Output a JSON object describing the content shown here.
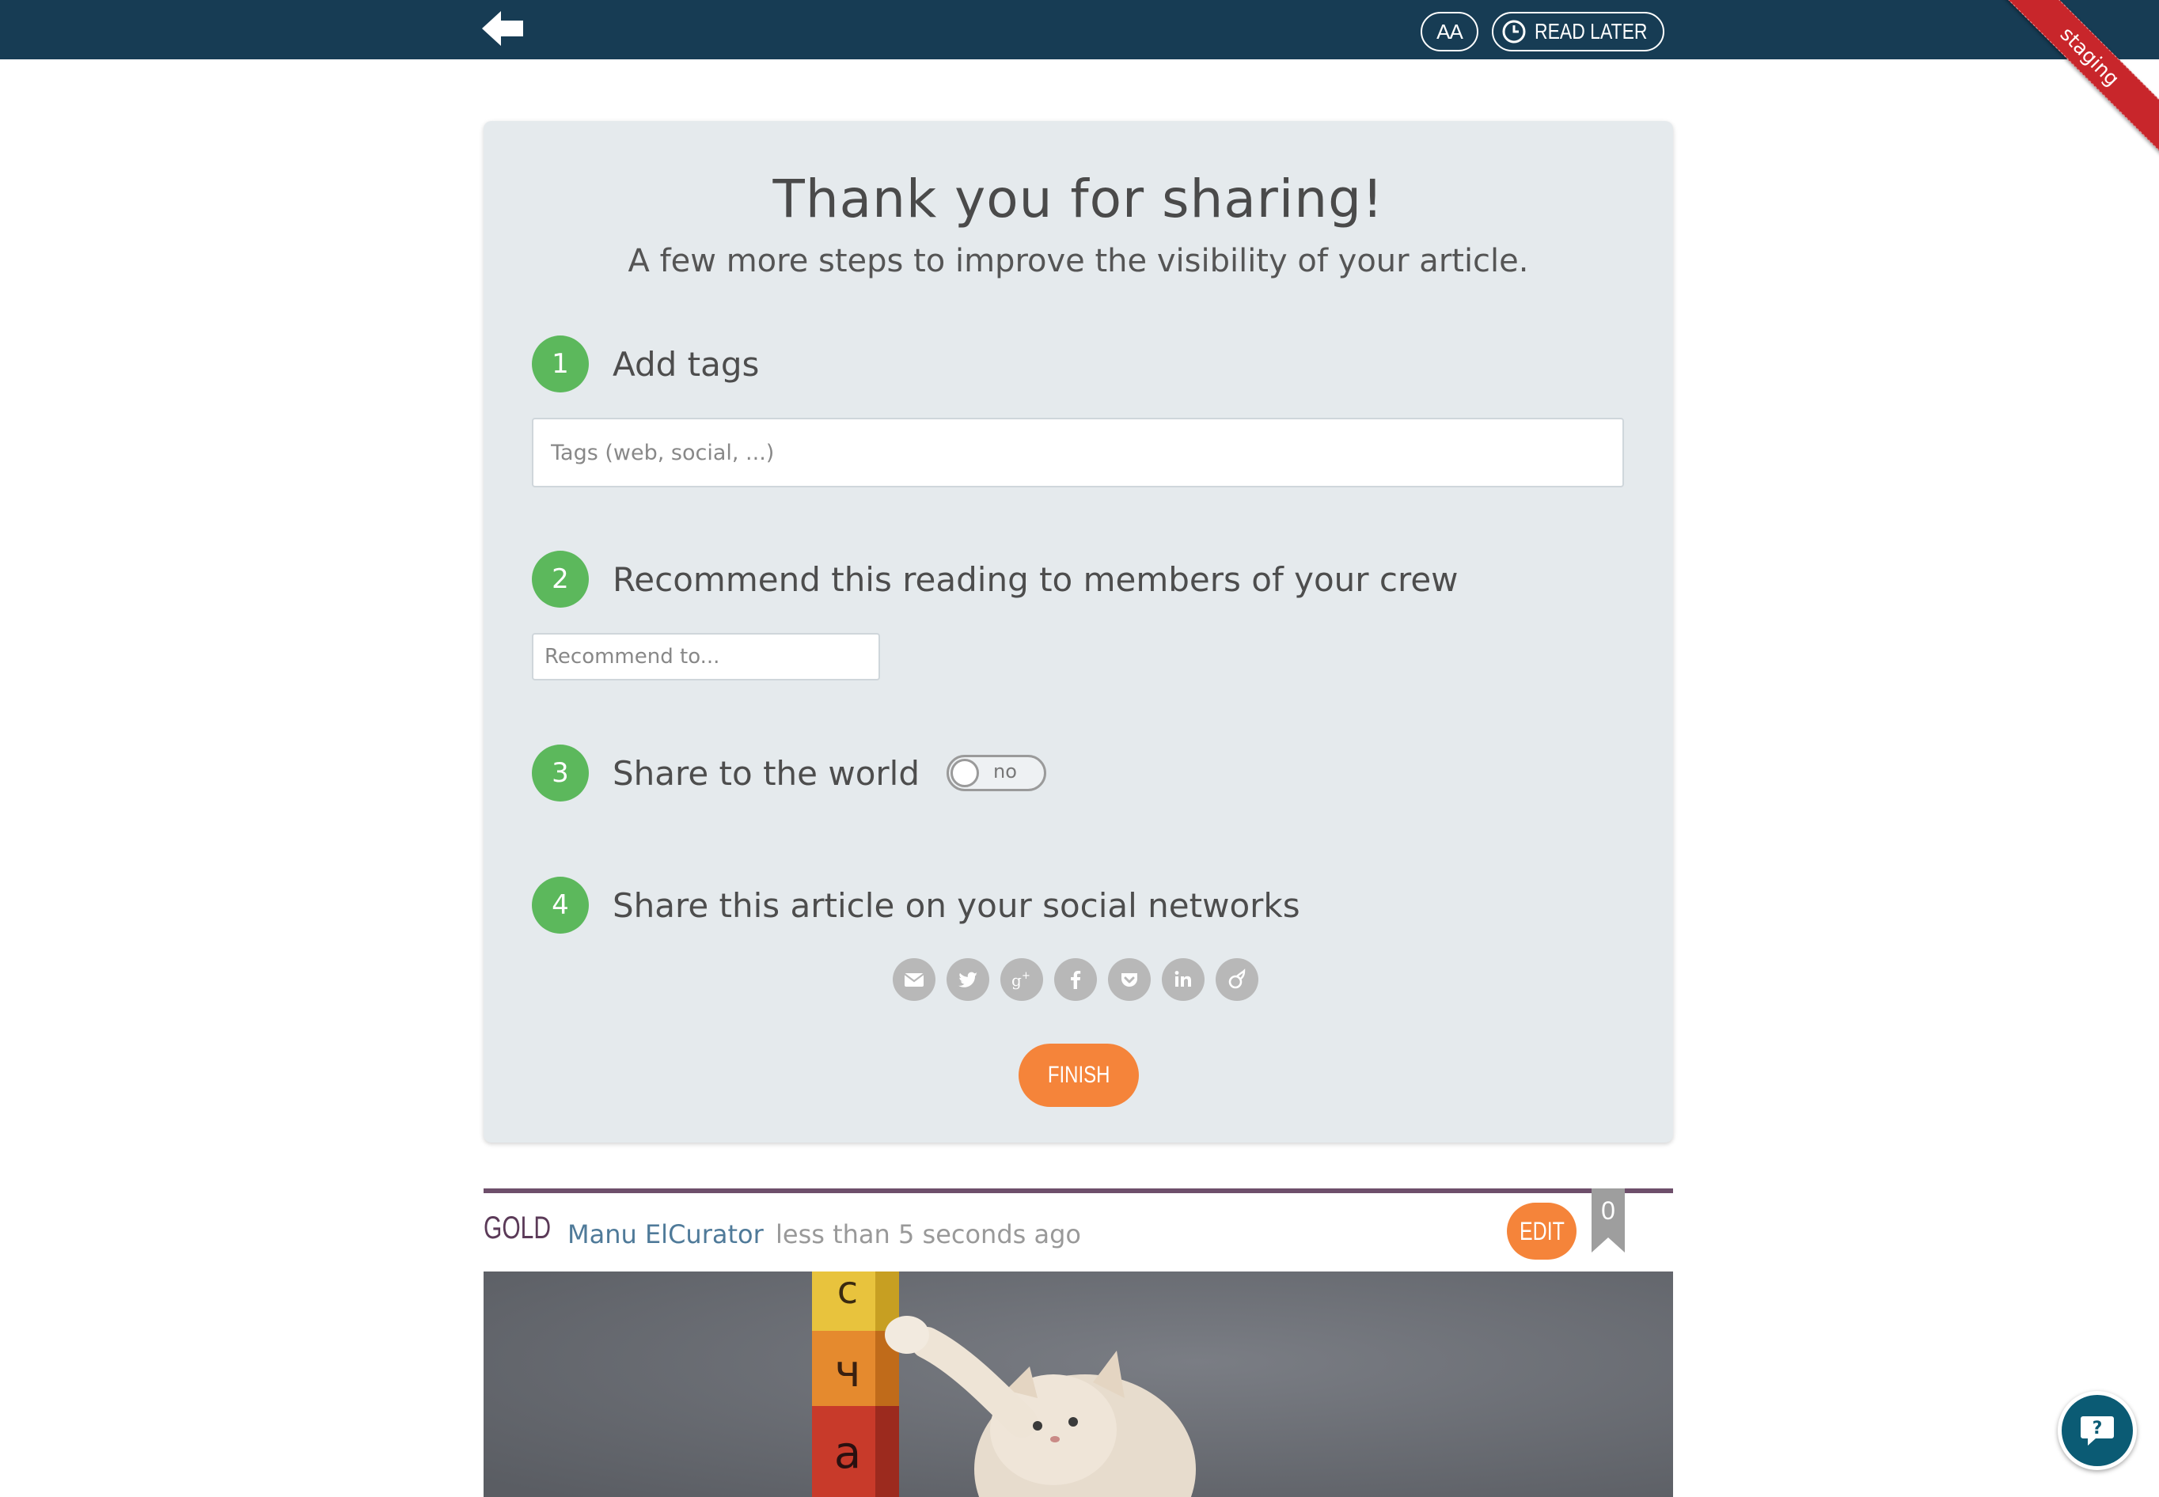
{
  "header": {
    "font_size_label": "AA",
    "read_later_label": "READ LATER",
    "env_ribbon": "staging"
  },
  "card": {
    "title": "Thank you for sharing!",
    "subtitle": "A few more steps to improve the visibility of your article.",
    "steps": [
      {
        "number": "1",
        "label": "Add tags"
      },
      {
        "number": "2",
        "label": "Recommend this reading to members of your crew"
      },
      {
        "number": "3",
        "label": "Share to the world"
      },
      {
        "number": "4",
        "label": "Share this article on your social networks"
      }
    ],
    "tags_placeholder": "Tags (web, social, ...)",
    "recommend_placeholder": "Recommend to...",
    "share_toggle": {
      "label": "no",
      "on": false
    },
    "social_icons": [
      "email-icon",
      "twitter-icon",
      "google-plus-icon",
      "facebook-icon",
      "pocket-icon",
      "linkedin-icon",
      "viadeo-icon"
    ],
    "finish_label": "FINISH"
  },
  "article": {
    "category": "GOLD",
    "author": "Manu ElCurator",
    "time": "less than 5 seconds ago",
    "edit_label": "EDIT",
    "bookmark_count": "0"
  },
  "colors": {
    "topbar": "#173c54",
    "step_green": "#5cb85c",
    "accent_orange": "#f5843a",
    "ribbon_red": "#c8262b",
    "card_bg": "#e5eaed"
  }
}
